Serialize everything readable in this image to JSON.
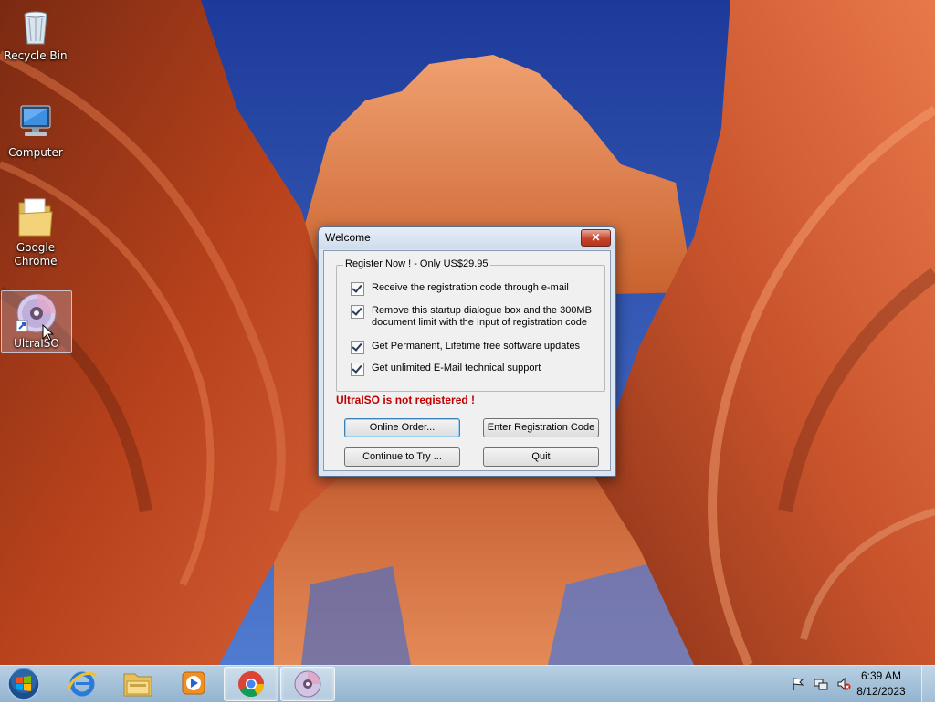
{
  "desktop": {
    "icons": [
      {
        "label": "Recycle Bin",
        "icon": "recycle-bin-icon"
      },
      {
        "label": "Computer",
        "icon": "computer-icon"
      },
      {
        "label": "Google Chrome",
        "icon": "folder-icon"
      },
      {
        "label": "UltraISO",
        "icon": "ultraiso-disc-icon"
      }
    ]
  },
  "dialog": {
    "title": "Welcome",
    "close_symbol": "✕",
    "group_title": "Register Now ! - Only US$29.95",
    "options": [
      {
        "label": "Receive the registration code through e-mail",
        "checked": true
      },
      {
        "label_line1": "Remove this startup dialogue box and the 300MB",
        "label_line2": "document limit with the Input of registration code",
        "checked": true
      },
      {
        "label": "Get Permanent, Lifetime free software updates",
        "checked": true
      },
      {
        "label": "Get unlimited E-Mail technical support",
        "checked": true
      }
    ],
    "status": "UltraISO is not registered !",
    "status_color": "#c00000",
    "buttons": {
      "online_order": "Online Order...",
      "enter_code": "Enter Registration Code",
      "continue": "Continue to Try ...",
      "quit": "Quit"
    }
  },
  "taskbar": {
    "items": [
      "start-orb-icon",
      "internet-explorer-icon",
      "windows-explorer-icon",
      "media-player-icon",
      "chrome-icon",
      "ultraiso-icon"
    ],
    "tray": [
      "action-center-flag-icon",
      "network-icon",
      "volume-muted-icon"
    ],
    "clock": {
      "time": "6:39 AM",
      "date": "8/12/2023"
    }
  }
}
